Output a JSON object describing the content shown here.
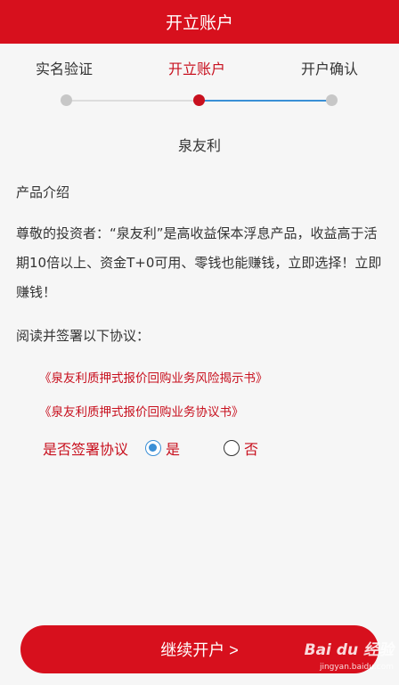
{
  "header": {
    "title": "开立账户"
  },
  "steps": [
    {
      "label": "实名验证",
      "state": "done"
    },
    {
      "label": "开立账户",
      "state": "active"
    },
    {
      "label": "开户确认",
      "state": "pending"
    }
  ],
  "product": {
    "name": "泉友利",
    "section_title": "产品介绍",
    "description": "尊敬的投资者：“泉友利”是高收益保本浮息产品，收益高于活期10倍以上、资金T+0可用、零钱也能赚钱，立即选择！立即赚钱！"
  },
  "agreements": {
    "read_label": "阅读并签署以下协议：",
    "items": [
      "《泉友利质押式报价回购业务风险揭示书》",
      "《泉友利质押式报价回购业务协议书》"
    ]
  },
  "sign": {
    "label": "是否签署协议",
    "options": [
      "是",
      "否"
    ],
    "selected": "是"
  },
  "continue_button": {
    "label": "继续开户 >"
  },
  "watermark": {
    "brand": "Bai du 经验",
    "url": "jingyan.baidu.com"
  },
  "colors": {
    "brand_red": "#d7101d",
    "accent_blue": "#3a8fd6"
  }
}
